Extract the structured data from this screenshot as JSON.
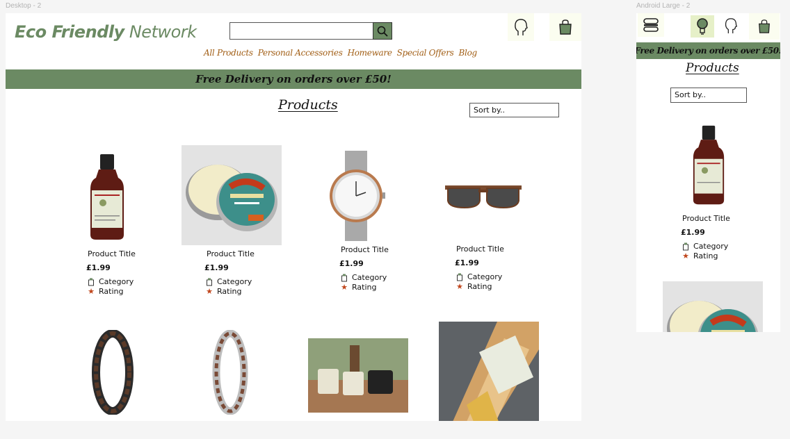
{
  "frames": {
    "desktop_label": "Desktop - 2",
    "android_label": "Android Large - 2"
  },
  "header": {
    "logo_bold": "Eco Friendly",
    "logo_light": "Network",
    "search_placeholder": "",
    "icons": [
      "search-icon",
      "account-icon",
      "basket-icon"
    ]
  },
  "nav": {
    "items": [
      "All Products",
      "Personal Accessories",
      "Homeware",
      "Special Offers",
      "Blog"
    ]
  },
  "banner": {
    "text": "Free Delivery on orders over £50!"
  },
  "products_section": {
    "title": "Products",
    "sort_placeholder": "Sort by.."
  },
  "products": [
    {
      "title": "Product Title",
      "price": "£1.99",
      "category": "Category",
      "rating": "Rating",
      "image": "soap-bottle"
    },
    {
      "title": "Product Title",
      "price": "£1.99",
      "category": "Category",
      "rating": "Rating",
      "image": "shave-tin"
    },
    {
      "title": "Product Title",
      "price": "£1.99",
      "category": "Category",
      "rating": "Rating",
      "image": "watch"
    },
    {
      "title": "Product Title",
      "price": "£1.99",
      "category": "Category",
      "rating": "Rating",
      "image": "sunglasses"
    }
  ],
  "row2_images": [
    "dark-wood-bracelet",
    "silver-wood-bracelet",
    "candles",
    "beeswax-wrap-kit"
  ],
  "android": {
    "banner_text": "Free Delivery on orders over £50!",
    "title": "Products",
    "sort_placeholder": "Sort by..",
    "icons": [
      "menu-icon",
      "lightbulb-icon",
      "account-icon",
      "basket-icon"
    ],
    "product": {
      "title": "Product Title",
      "price": "£1.99",
      "category": "Category",
      "rating": "Rating"
    }
  },
  "colors": {
    "brand_green": "#6b8a63",
    "nav_brown": "#a15e15",
    "star": "#c0461c",
    "icon_bg": "#fbfdf0"
  }
}
